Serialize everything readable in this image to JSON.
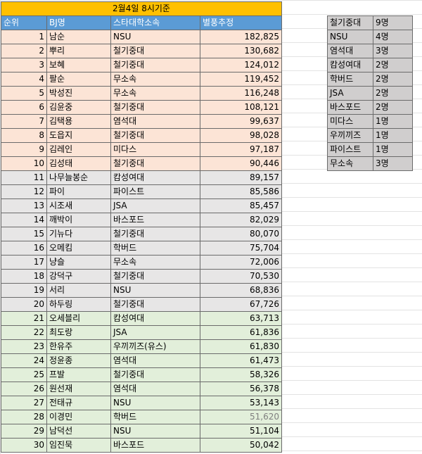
{
  "title": "2월4일 8시기준",
  "headers": [
    "순위",
    "BJ명",
    "스타대학소속",
    "별풍추정"
  ],
  "rows": [
    [
      "1",
      "남순",
      "NSU",
      "182,825"
    ],
    [
      "2",
      "뿌리",
      "철기중대",
      "130,682"
    ],
    [
      "3",
      "보혜",
      "철기중대",
      "124,012"
    ],
    [
      "4",
      "팔순",
      "무소속",
      "119,452"
    ],
    [
      "5",
      "박성진",
      "무소속",
      "116,248"
    ],
    [
      "6",
      "김윤중",
      "철기중대",
      "108,121"
    ],
    [
      "7",
      "김택용",
      "염석대",
      "99,637"
    ],
    [
      "8",
      "도읍지",
      "철기중대",
      "98,028"
    ],
    [
      "9",
      "김레인",
      "미다스",
      "97,187"
    ],
    [
      "10",
      "김성태",
      "철기중대",
      "90,446"
    ],
    [
      "11",
      "나무늘봉순",
      "캄성여대",
      "89,157"
    ],
    [
      "12",
      "파이",
      "파이스트",
      "85,586"
    ],
    [
      "13",
      "시조새",
      "JSA",
      "85,457"
    ],
    [
      "14",
      "깨박이",
      "바스포드",
      "82,029"
    ],
    [
      "15",
      "기뉴다",
      "철기중대",
      "80,070"
    ],
    [
      "16",
      "오메킴",
      "학버드",
      "75,704"
    ],
    [
      "17",
      "냥슬",
      "무소속",
      "72,006"
    ],
    [
      "18",
      "강덕구",
      "철기중대",
      "70,530"
    ],
    [
      "19",
      "서리",
      "NSU",
      "68,836"
    ],
    [
      "20",
      "하두링",
      "철기중대",
      "67,726"
    ],
    [
      "21",
      "오세블리",
      "캄성여대",
      "63,713"
    ],
    [
      "22",
      "최도랑",
      "JSA",
      "61,836"
    ],
    [
      "23",
      "한유주",
      "우끼끼즈(유스)",
      "61,830"
    ],
    [
      "24",
      "정윤종",
      "염석대",
      "61,473"
    ],
    [
      "25",
      "프발",
      "철기중대",
      "58,326"
    ],
    [
      "26",
      "원선재",
      "염석대",
      "56,378"
    ],
    [
      "27",
      "전태규",
      "NSU",
      "53,143"
    ],
    [
      "28",
      "이경민",
      "학버드",
      "51,620"
    ],
    [
      "29",
      "남덕선",
      "NSU",
      "51,104"
    ],
    [
      "30",
      "임진묵",
      "바스포드",
      "50,042"
    ]
  ],
  "summary": [
    [
      "철기중대",
      "9명"
    ],
    [
      "NSU",
      "4명"
    ],
    [
      "염석대",
      "3명"
    ],
    [
      "캄성여대",
      "2명"
    ],
    [
      "학버드",
      "2명"
    ],
    [
      "JSA",
      "2명"
    ],
    [
      "바스포드",
      "2명"
    ],
    [
      "미다스",
      "1명"
    ],
    [
      "우끼끼즈",
      "1명"
    ],
    [
      "파이스트",
      "1명"
    ],
    [
      "무소속",
      "3명"
    ]
  ],
  "colors": {
    "title_bg": "#ffc000",
    "header_bg": "#5b9bd5",
    "rank_1_10_bg": "#fce4d6",
    "rank_11_20_bg": "#e7e6e6",
    "rank_21_30_bg": "#e2efda",
    "summary_bg": "#d0cece"
  }
}
